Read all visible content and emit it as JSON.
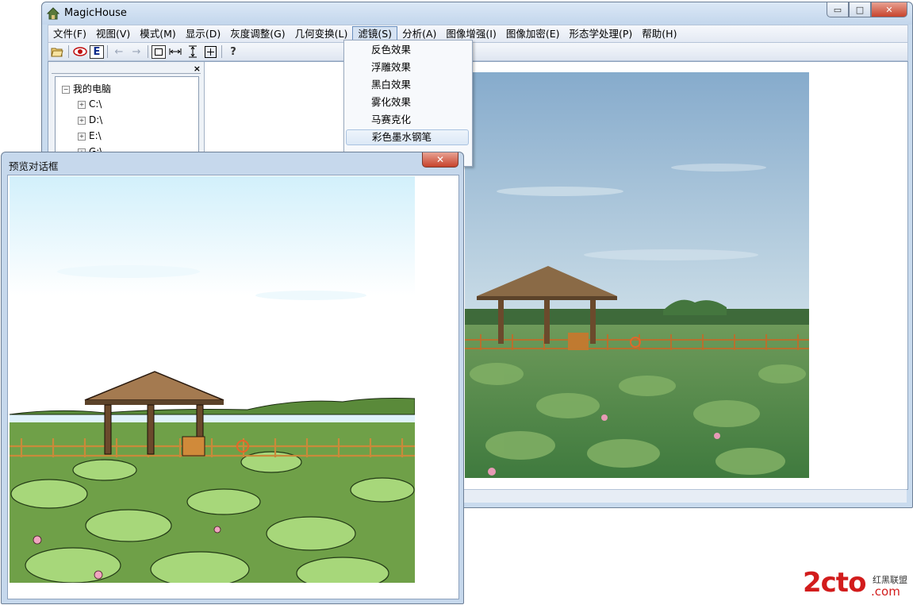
{
  "app": {
    "title": "MagicHouse"
  },
  "menu": [
    "文件(F)",
    "视图(V)",
    "模式(M)",
    "显示(D)",
    "灰度调整(G)",
    "几何变换(L)",
    "滤镜(S)",
    "分析(A)",
    "图像增强(I)",
    "图像加密(E)",
    "形态学处理(P)",
    "帮助(H)"
  ],
  "toolbar": {
    "e_label": "E",
    "help_label": "?"
  },
  "tree": {
    "close": "×",
    "root": "我的电脑",
    "drives": [
      "C:\\",
      "D:\\",
      "E:\\",
      "G:\\"
    ]
  },
  "filter_menu": {
    "items": [
      "反色效果",
      "浮雕效果",
      "黑白效果",
      "雾化效果",
      "马赛克化",
      "彩色墨水钢笔"
    ],
    "highlighted_index": 5
  },
  "dialog": {
    "title": "预览对话框",
    "close": "✕"
  },
  "window_buttons": {
    "min": "▭",
    "max": "□",
    "close": "✕"
  },
  "watermark": {
    "brand": "2cto",
    "suffix": ".com",
    "tag": "红黑联盟"
  },
  "colors": {
    "menu_highlight": "#d6e3f3",
    "close_red": "#c7432c",
    "frame": "#c9dbee"
  }
}
